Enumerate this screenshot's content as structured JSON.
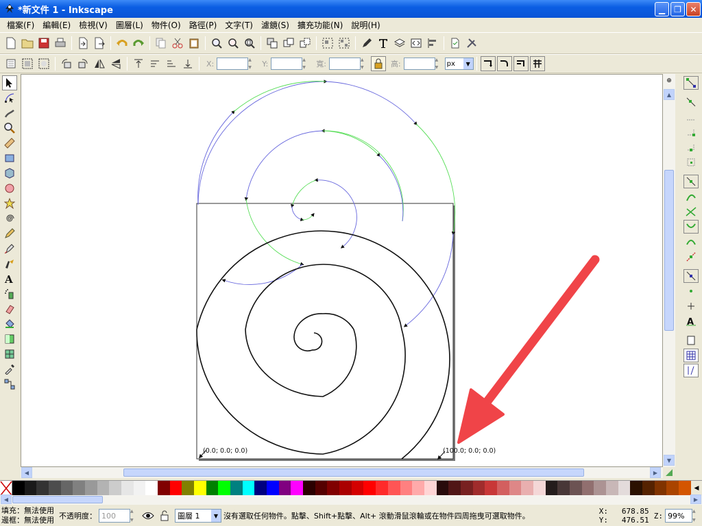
{
  "window": {
    "title": "*新文件 1 - Inkscape"
  },
  "menu": [
    {
      "id": "file",
      "label": "檔案(F)"
    },
    {
      "id": "edit",
      "label": "編輯(E)"
    },
    {
      "id": "view",
      "label": "檢視(V)"
    },
    {
      "id": "layer",
      "label": "圖層(L)"
    },
    {
      "id": "object",
      "label": "物件(O)"
    },
    {
      "id": "path",
      "label": "路徑(P)"
    },
    {
      "id": "text",
      "label": "文字(T)"
    },
    {
      "id": "filters",
      "label": "濾鏡(S)"
    },
    {
      "id": "extensions",
      "label": "擴充功能(N)"
    },
    {
      "id": "help",
      "label": "說明(H)"
    }
  ],
  "toolbar2": {
    "x_label": "X:",
    "y_label": "Y:",
    "w_label": "寬:",
    "h_label": "高:",
    "unit": "px"
  },
  "canvas": {
    "label_origin": "(0.0; 0.0; 0.0)",
    "label_corner": "(100.0; 0.0; 0.0)"
  },
  "palette_colors": [
    "#000000",
    "#1a1a1a",
    "#333333",
    "#4d4d4d",
    "#666666",
    "#808080",
    "#999999",
    "#b3b3b3",
    "#cccccc",
    "#e6e6e6",
    "#f2f2f2",
    "#ffffff",
    "#800000",
    "#ff0000",
    "#808000",
    "#ffff00",
    "#008000",
    "#00ff00",
    "#008080",
    "#00ffff",
    "#000080",
    "#0000ff",
    "#800080",
    "#ff00ff",
    "#2b0000",
    "#550000",
    "#800000",
    "#aa0000",
    "#d40000",
    "#ff0000",
    "#ff2a2a",
    "#ff5555",
    "#ff8080",
    "#ffaaaa",
    "#ffd5d5",
    "#280b0b",
    "#501616",
    "#782121",
    "#a02c2c",
    "#c83737",
    "#d35f5f",
    "#de8787",
    "#e9afaf",
    "#f4d7d7",
    "#241c1c",
    "#483737",
    "#6c5353",
    "#916f6f",
    "#ac9393",
    "#c8b7b7",
    "#e3dbdb",
    "#2b1100",
    "#552200",
    "#803300",
    "#aa4400",
    "#d45500"
  ],
  "status": {
    "fill_label": "填充：",
    "fill_value": "無法使用",
    "stroke_label": "邊框：",
    "stroke_value": "無法使用",
    "opacity_label": "不透明度：",
    "opacity_value": "100",
    "layer_value": "圖層 1",
    "message": "沒有選取任何物件。點擊、Shift+點擊、Alt+ 滾動滑鼠滾輪或在物件四周拖曳可選取物件。",
    "x_readout": "X:   678.85",
    "y_readout": "Y:   476.51",
    "zoom_label": "Z:",
    "zoom_value": "99%"
  },
  "colors": {
    "spiral_blue": "#6666dd",
    "spiral_green": "#55dd55",
    "arrow_red": "#f04448",
    "titlebar": "#0a5ce3"
  }
}
